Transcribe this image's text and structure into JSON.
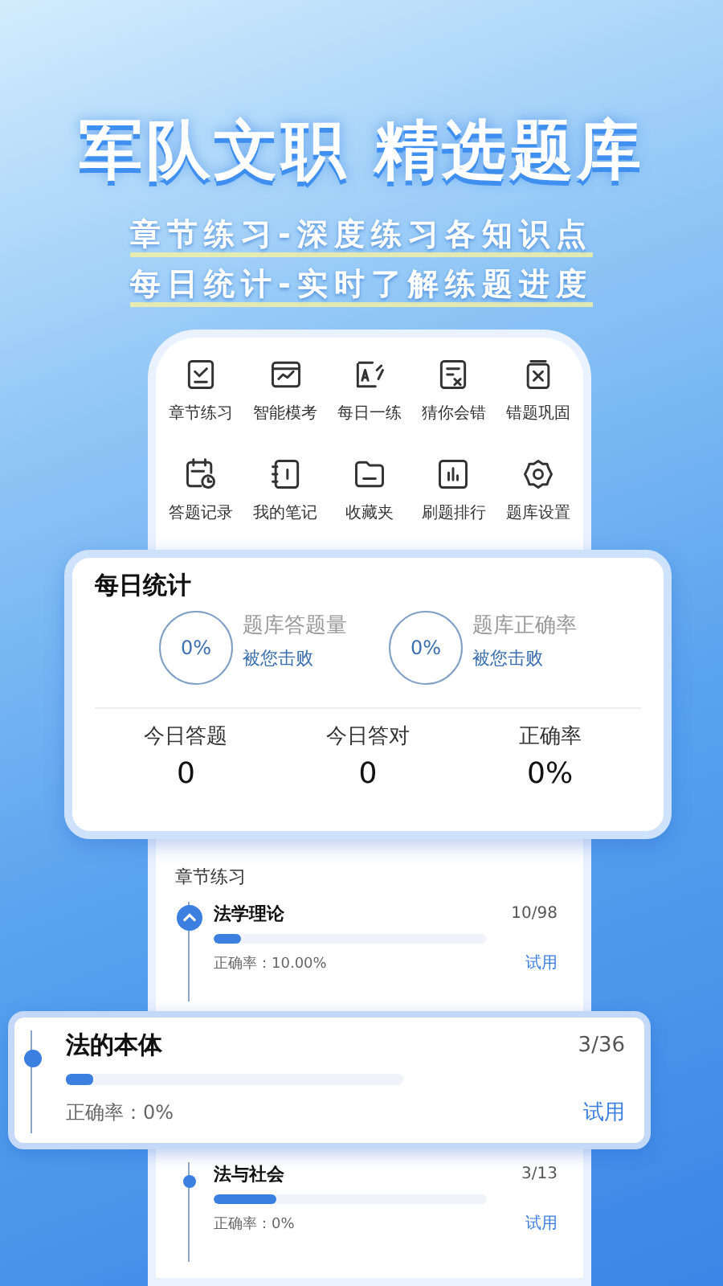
{
  "hero": {
    "title": "军队文职 精选题库",
    "subtitles": [
      "章节练习-深度练习各知识点",
      "每日统计-实时了解练题进度"
    ]
  },
  "menu": [
    {
      "label": "章节练习"
    },
    {
      "label": "智能模考"
    },
    {
      "label": "每日一练"
    },
    {
      "label": "猜你会错"
    },
    {
      "label": "错题巩固"
    },
    {
      "label": "答题记录"
    },
    {
      "label": "我的笔记"
    },
    {
      "label": "收藏夹"
    },
    {
      "label": "刷题排行"
    },
    {
      "label": "题库设置"
    }
  ],
  "daily_stats": {
    "title": "每日统计",
    "rings": [
      {
        "value": "0%",
        "label": "题库答题量",
        "note": "被您击败"
      },
      {
        "value": "0%",
        "label": "题库正确率",
        "note": "被您击败"
      }
    ],
    "totals": [
      {
        "label": "今日答题",
        "value": "0"
      },
      {
        "label": "今日答对",
        "value": "0"
      },
      {
        "label": "正确率",
        "value": "0%"
      }
    ]
  },
  "chapters": {
    "title": "章节练习",
    "items": [
      {
        "title": "法学理论",
        "count": "10/98",
        "accuracy": "正确率：10.00%",
        "action": "试用",
        "level": 0.1,
        "expanded": true,
        "selected": false
      },
      {
        "title": "法的本体",
        "count": "3/36",
        "accuracy": "正确率：0%",
        "action": "试用",
        "level": 0.08,
        "expanded": false,
        "selected": true
      },
      {
        "title": "法与社会",
        "count": "3/13",
        "accuracy": "正确率：0%",
        "action": "试用",
        "level": 0.23,
        "expanded": false,
        "selected": false
      }
    ]
  }
}
